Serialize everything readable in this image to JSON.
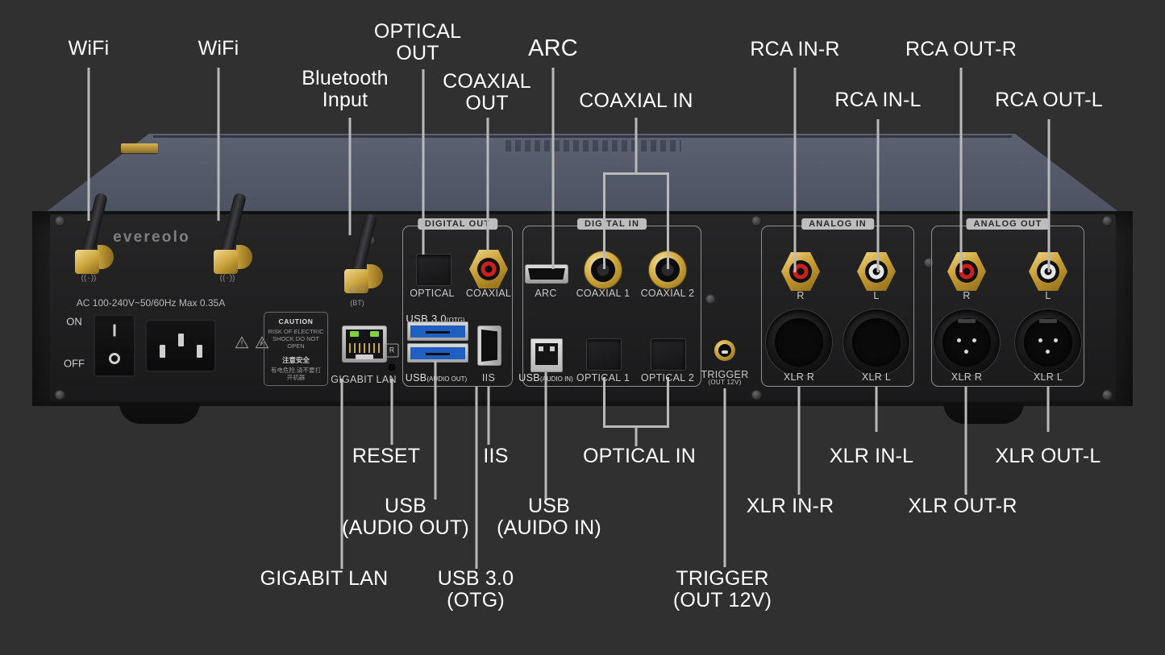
{
  "device": {
    "brand": "evereolo",
    "power": {
      "ac_spec": "AC 100-240V~50/60Hz Max 0.35A",
      "on": "ON",
      "off": "OFF",
      "caution_title": "CAUTION",
      "caution_body": "RISK OF ELECTRIC\nSHOCK DO NOT\nOPEN",
      "caution_cn_title": "注意安全",
      "caution_cn_body": "有电危险,请不要打\n开机器"
    },
    "antenna_symbol": "((٠))",
    "bt_label": "(BT)"
  },
  "groups": [
    {
      "title": "DIGITAL OUT"
    },
    {
      "title": "DIGITAL IN"
    },
    {
      "title": "ANALOG IN"
    },
    {
      "title": "ANALOG OUT"
    }
  ],
  "port_labels": {
    "optical_out": "OPTICAL",
    "coaxial_out": "COAXIAL",
    "usb30_otg_main": "USB 3.0",
    "usb30_otg_sub": "(OTG)",
    "usb_audio_out_main": "USB",
    "usb_audio_out_sub": "(AUDIO OUT)",
    "iis": "IIS",
    "gigabit_lan": "GIGABIT LAN",
    "reset_mark": "R",
    "arc": "ARC",
    "coaxial_1": "COAXIAL 1",
    "coaxial_2": "COAXIAL 2",
    "usb_audio_in_main": "USB",
    "usb_audio_in_sub": "(AUDIO IN)",
    "optical_1": "OPTICAL 1",
    "optical_2": "OPTICAL 2",
    "trigger_main": "TRIGGER",
    "trigger_sub": "(OUT 12V)",
    "rca_in_r": "R",
    "rca_in_l": "L",
    "xlr_in_r": "XLR R",
    "xlr_in_l": "XLR L",
    "rca_out_r": "R",
    "rca_out_l": "L",
    "xlr_out_r": "XLR R",
    "xlr_out_l": "XLR L"
  },
  "callouts": {
    "wifi_1": "WiFi",
    "wifi_2": "WiFi",
    "bluetooth_input": "Bluetooth\nInput",
    "optical_out": "OPTICAL\nOUT",
    "coaxial_out": "COAXIAL\nOUT",
    "arc": "ARC",
    "coaxial_in": "COAXIAL IN",
    "rca_in_r": "RCA IN-R",
    "rca_in_l": "RCA IN-L",
    "rca_out_r": "RCA OUT-R",
    "rca_out_l": "RCA OUT-L",
    "reset": "RESET",
    "iis": "IIS",
    "optical_in": "OPTICAL IN",
    "xlr_in_l": "XLR IN-L",
    "xlr_out_l": "XLR OUT-L",
    "usb_audio_out": "USB\n(AUDIO OUT)",
    "usb_audio_in": "USB\n(AUIDO IN)",
    "xlr_in_r": "XLR IN-R",
    "xlr_out_r": "XLR OUT-R",
    "gigabit_lan": "GIGABIT LAN",
    "usb_30_otg": "USB 3.0\n(OTG)",
    "trigger": "TRIGGER\n(OUT 12V)"
  },
  "colors": {
    "background": "#303030",
    "callout_text": "#ffffff",
    "leader": "#b9b9b9",
    "top_plate": "#525867",
    "gold": "#c79c33",
    "rca_red": "#cc2020",
    "rca_white": "#e8e8e8",
    "usb_blue": "#1f5fbf"
  }
}
